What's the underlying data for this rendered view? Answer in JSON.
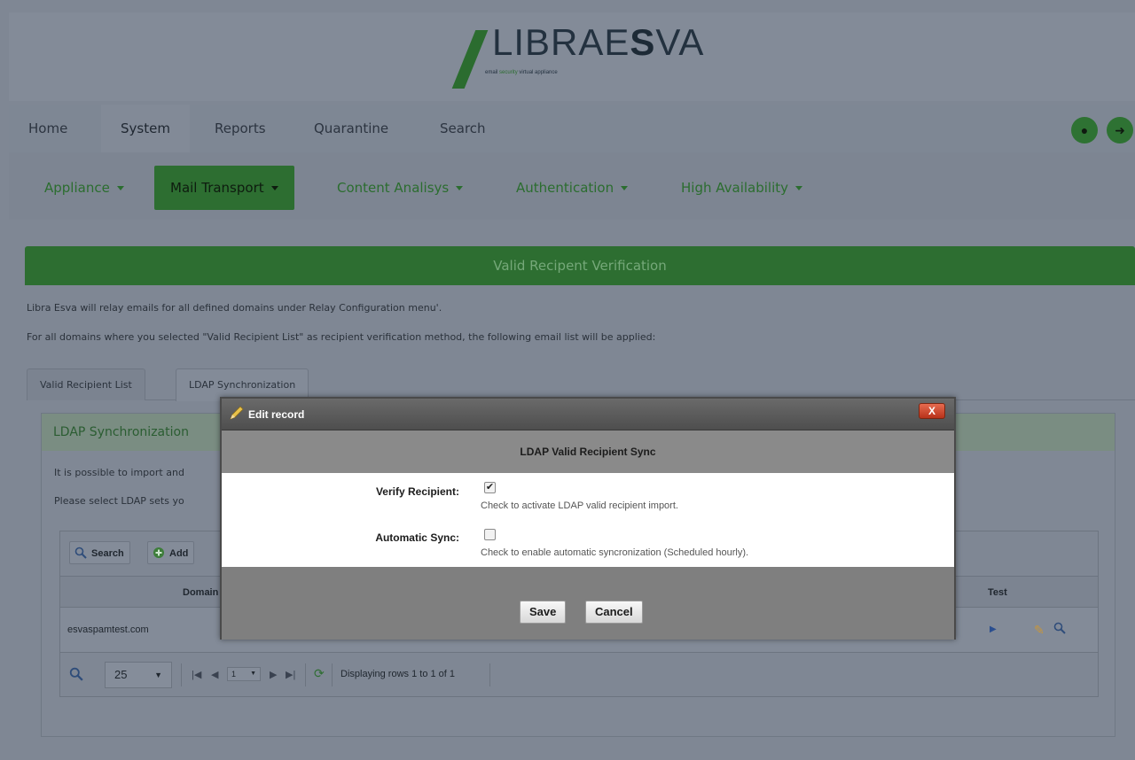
{
  "brand": {
    "logo_main": "LIBRAE",
    "logo_bold": "S",
    "logo_end": "VA",
    "logo_e": "E",
    "tagline_a": "email ",
    "tagline_b": "security",
    "tagline_c": " virtual appliance",
    "green": "#2d6e31"
  },
  "topnav": {
    "tabs": [
      "Home",
      "System",
      "Reports",
      "Quarantine",
      "Search"
    ],
    "active": "System"
  },
  "subnav": {
    "items": [
      "Appliance",
      "Mail Transport",
      "Content Analisys",
      "Authentication",
      "High Availability"
    ],
    "active": "Mail Transport"
  },
  "panel": {
    "title": "Valid Recipent Verification",
    "desc1": "Libra Esva will relay emails for all defined domains under Relay Configuration menu'.",
    "desc2": "For all domains where you selected \"Valid Recipient List\" as recipient verification method, the following email list will be applied:"
  },
  "tabs": [
    "Valid Recipient List",
    "LDAP Synchronization"
  ],
  "subpanel": {
    "title": "LDAP Synchronization",
    "text1": "It is possible to import and",
    "text2": "Please select LDAP sets yo"
  },
  "grid": {
    "toolbar": {
      "search": "Search",
      "add": "Add"
    },
    "columns": {
      "domain": "Domain",
      "test": "Test"
    },
    "rows": [
      {
        "domain": "esvaspamtest.com"
      }
    ],
    "pager": {
      "page_size": "25",
      "page": "1",
      "status": "Displaying rows 1 to 1 of 1"
    }
  },
  "modal": {
    "title": "Edit record",
    "close": "X",
    "subtitle": "LDAP Valid Recipient Sync",
    "fields": [
      {
        "label": "Verify Recipient:",
        "checked": true,
        "hint": "Check to activate LDAP valid recipient import."
      },
      {
        "label": "Automatic Sync:",
        "checked": false,
        "hint": "Check to enable automatic syncronization (Scheduled hourly)."
      }
    ],
    "save": "Save",
    "cancel": "Cancel"
  }
}
